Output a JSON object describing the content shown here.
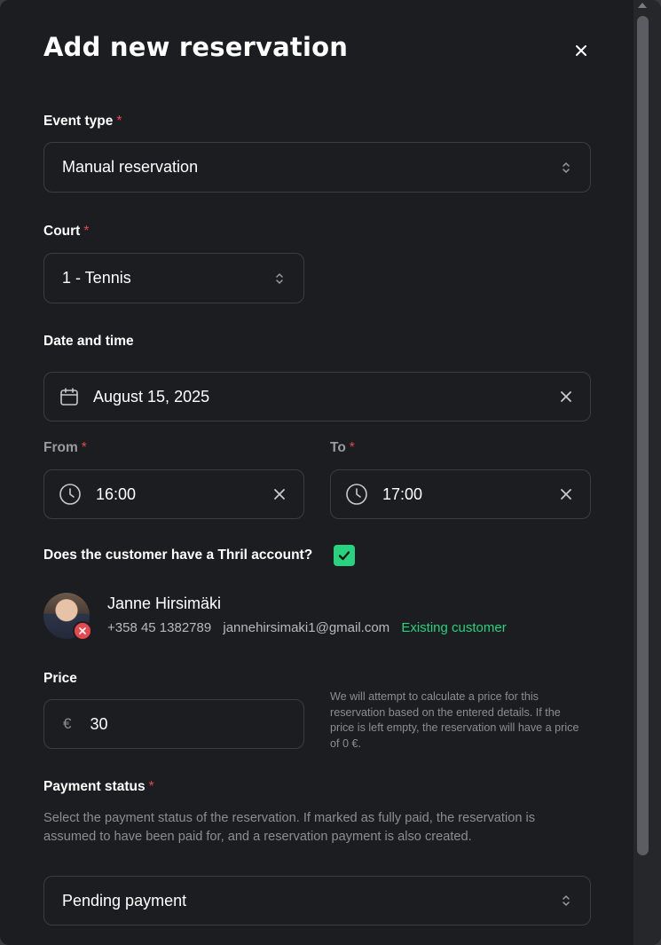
{
  "modal": {
    "title": "Add new reservation"
  },
  "event_type": {
    "label": "Event type",
    "required": "*",
    "value": "Manual reservation"
  },
  "court": {
    "label": "Court",
    "required": "*",
    "value": "1 - Tennis"
  },
  "date_time": {
    "label": "Date and time",
    "date_value": "August 15, 2025",
    "from_label": "From",
    "from_required": "*",
    "from_value": "16:00",
    "to_label": "To",
    "to_required": "*",
    "to_value": "17:00"
  },
  "account": {
    "question": "Does the customer have a Thril account?",
    "checked": true
  },
  "customer": {
    "name": "Janne Hirsimäki",
    "phone": "+358 45 1382789",
    "email": "jannehirsimaki1@gmail.com",
    "status": "Existing customer"
  },
  "price": {
    "label": "Price",
    "currency": "€",
    "value": "30",
    "help": "We will attempt to calculate a price for this reservation based on the entered details. If the price is left empty, the reservation will have a price of 0 €."
  },
  "payment_status": {
    "label": "Payment status",
    "required": "*",
    "help": "Select the payment status of the reservation. If marked as fully paid, the reservation is assumed to have been paid for, and a reservation payment is also created.",
    "value": "Pending payment"
  },
  "icons": {
    "close": "close-icon",
    "chevron": "chevron-updown-icon",
    "calendar": "calendar-icon",
    "clock": "clock-icon",
    "check": "check-icon",
    "remove": "remove-icon"
  },
  "colors": {
    "accent_green": "#2ad17e",
    "required_red": "#e5484d",
    "background": "#1c1d20"
  }
}
